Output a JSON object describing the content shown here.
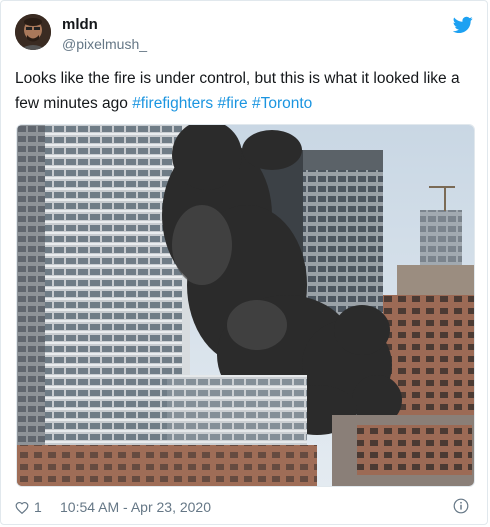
{
  "tweet": {
    "author": {
      "display_name": "mldn",
      "handle": "@pixelmush_",
      "avatar_icon": "avatar-photo"
    },
    "brand_icon": "twitter-bird-icon",
    "text_plain": "Looks like the fire is under control, but this is what it looked like a few minutes ago ",
    "hashtags": [
      "#firefighters",
      "#fire",
      "#Toronto"
    ],
    "media": {
      "description_icon": "fire-photo",
      "smoke_color": "#2b2b2b",
      "sky_color": "#d8e2ec"
    },
    "footer": {
      "like_count": "1",
      "timestamp": "10:54 AM - Apr 23, 2020",
      "info_icon": "info-icon"
    },
    "colors": {
      "link": "#1b95e0",
      "brand": "#1da1f2",
      "muted": "#657786"
    }
  }
}
